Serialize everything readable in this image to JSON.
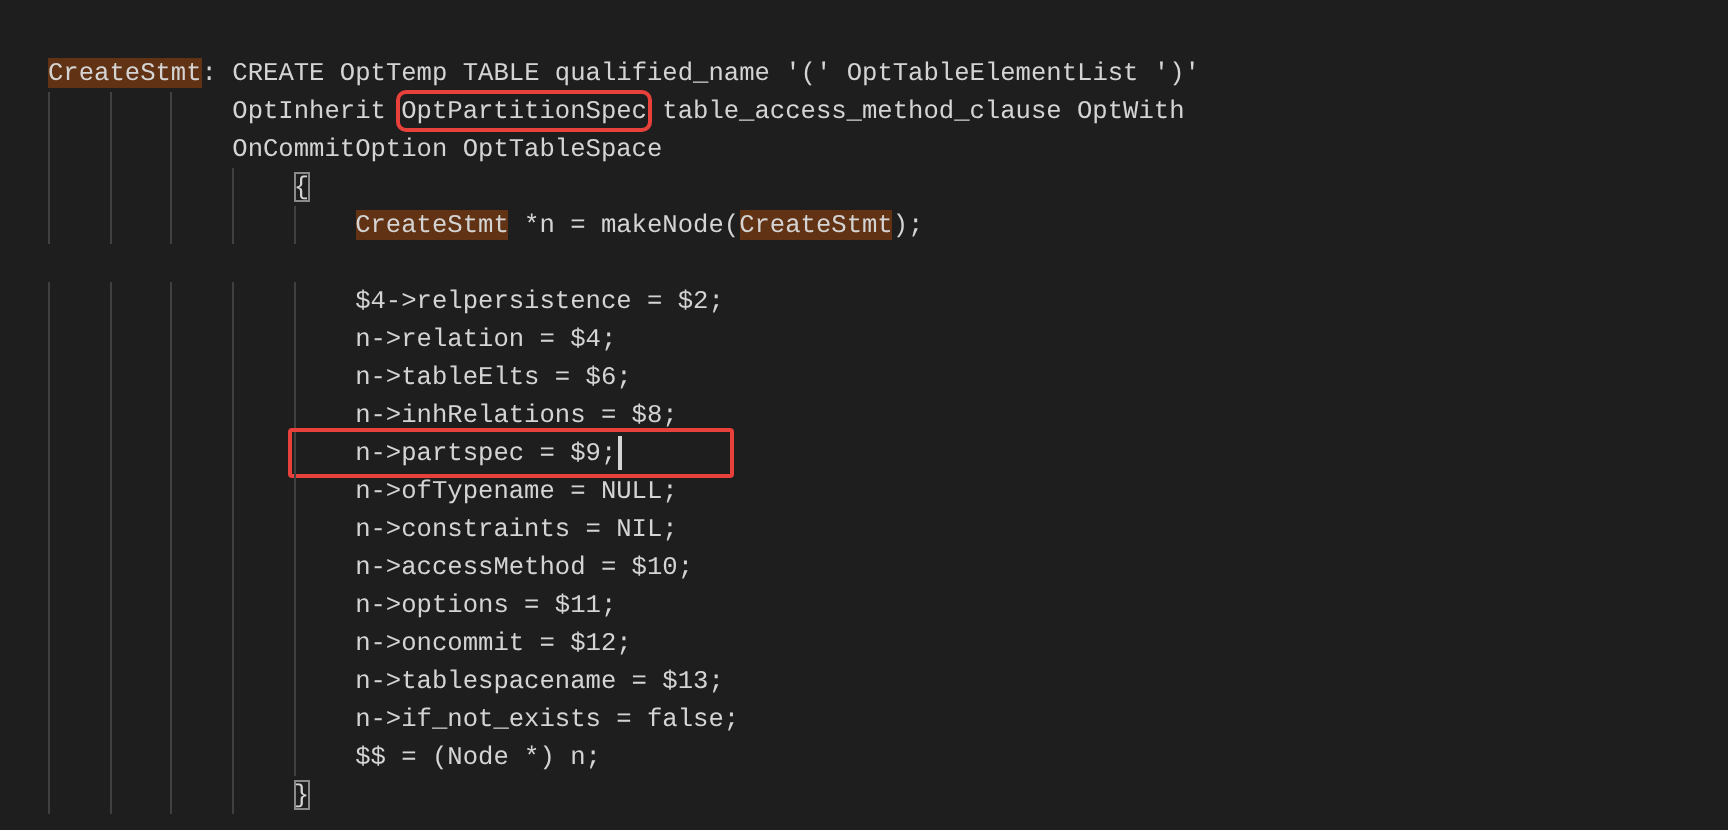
{
  "editor": {
    "lines": [
      {
        "segments": [
          {
            "text": "CreateStmt",
            "kind": "match"
          },
          {
            "text": ": CREATE OptTemp TABLE qualified_name '(' OptTableElementList ')'",
            "kind": "plain"
          }
        ]
      },
      {
        "segments": [
          {
            "text": "            OptInherit ",
            "kind": "plain"
          },
          {
            "text": "OptPartitionSpec",
            "kind": "plain",
            "boxed": true
          },
          {
            "text": " table_access_method_clause OptWith",
            "kind": "plain"
          }
        ]
      },
      {
        "segments": [
          {
            "text": "            OnCommitOption OptTableSpace",
            "kind": "plain"
          }
        ]
      },
      {
        "segments": [
          {
            "text": "                {",
            "kind": "bracket"
          }
        ]
      },
      {
        "segments": [
          {
            "text": "                    CreateStmt",
            "kind": "match"
          },
          {
            "text": " *n = makeNode(",
            "kind": "plain"
          },
          {
            "text": "CreateStmt",
            "kind": "match"
          },
          {
            "text": ");",
            "kind": "plain"
          }
        ]
      },
      {
        "gap_before": true,
        "segments": [
          {
            "text": "                    $4->relpersistence = $2;",
            "kind": "plain"
          }
        ]
      },
      {
        "segments": [
          {
            "text": "                    n->relation = $4;",
            "kind": "plain"
          }
        ]
      },
      {
        "segments": [
          {
            "text": "                    n->tableElts = $6;",
            "kind": "plain"
          }
        ]
      },
      {
        "segments": [
          {
            "text": "                    n->inhRelations = $8;",
            "kind": "plain"
          }
        ]
      },
      {
        "boxed": true,
        "cursor": true,
        "segments": [
          {
            "text": "                    n->partspec = $9;",
            "kind": "plain"
          }
        ]
      },
      {
        "segments": [
          {
            "text": "                    n->ofTypename = NULL;",
            "kind": "plain"
          }
        ]
      },
      {
        "segments": [
          {
            "text": "                    n->constraints = NIL;",
            "kind": "plain"
          }
        ]
      },
      {
        "segments": [
          {
            "text": "                    n->accessMethod = $10;",
            "kind": "plain"
          }
        ]
      },
      {
        "segments": [
          {
            "text": "                    n->options = $11;",
            "kind": "plain"
          }
        ]
      },
      {
        "segments": [
          {
            "text": "                    n->oncommit = $12;",
            "kind": "plain"
          }
        ]
      },
      {
        "segments": [
          {
            "text": "                    n->tablespacename = $13;",
            "kind": "plain"
          }
        ]
      },
      {
        "segments": [
          {
            "text": "                    n->if_not_exists = false;",
            "kind": "plain"
          }
        ]
      },
      {
        "segments": [
          {
            "text": "                    $$ = (Node *) n;",
            "kind": "plain"
          }
        ]
      },
      {
        "segments": [
          {
            "text": "                }",
            "kind": "bracket"
          }
        ]
      }
    ]
  }
}
